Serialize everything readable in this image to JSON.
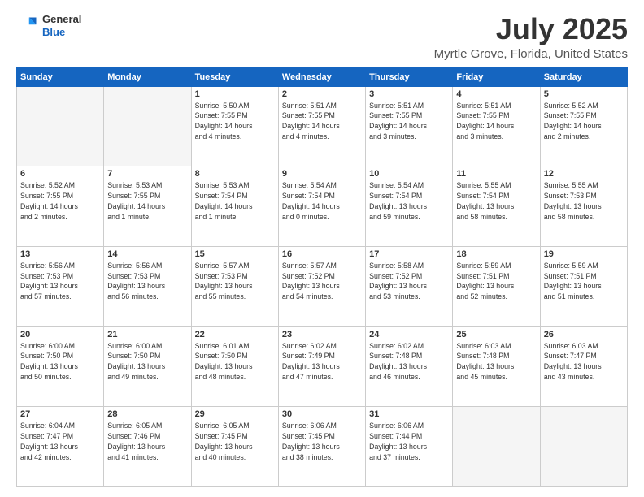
{
  "logo": {
    "general": "General",
    "blue": "Blue"
  },
  "header": {
    "title": "July 2025",
    "subtitle": "Myrtle Grove, Florida, United States"
  },
  "weekdays": [
    "Sunday",
    "Monday",
    "Tuesday",
    "Wednesday",
    "Thursday",
    "Friday",
    "Saturday"
  ],
  "weeks": [
    [
      {
        "day": "",
        "info": ""
      },
      {
        "day": "",
        "info": ""
      },
      {
        "day": "1",
        "info": "Sunrise: 5:50 AM\nSunset: 7:55 PM\nDaylight: 14 hours\nand 4 minutes."
      },
      {
        "day": "2",
        "info": "Sunrise: 5:51 AM\nSunset: 7:55 PM\nDaylight: 14 hours\nand 4 minutes."
      },
      {
        "day": "3",
        "info": "Sunrise: 5:51 AM\nSunset: 7:55 PM\nDaylight: 14 hours\nand 3 minutes."
      },
      {
        "day": "4",
        "info": "Sunrise: 5:51 AM\nSunset: 7:55 PM\nDaylight: 14 hours\nand 3 minutes."
      },
      {
        "day": "5",
        "info": "Sunrise: 5:52 AM\nSunset: 7:55 PM\nDaylight: 14 hours\nand 2 minutes."
      }
    ],
    [
      {
        "day": "6",
        "info": "Sunrise: 5:52 AM\nSunset: 7:55 PM\nDaylight: 14 hours\nand 2 minutes."
      },
      {
        "day": "7",
        "info": "Sunrise: 5:53 AM\nSunset: 7:55 PM\nDaylight: 14 hours\nand 1 minute."
      },
      {
        "day": "8",
        "info": "Sunrise: 5:53 AM\nSunset: 7:54 PM\nDaylight: 14 hours\nand 1 minute."
      },
      {
        "day": "9",
        "info": "Sunrise: 5:54 AM\nSunset: 7:54 PM\nDaylight: 14 hours\nand 0 minutes."
      },
      {
        "day": "10",
        "info": "Sunrise: 5:54 AM\nSunset: 7:54 PM\nDaylight: 13 hours\nand 59 minutes."
      },
      {
        "day": "11",
        "info": "Sunrise: 5:55 AM\nSunset: 7:54 PM\nDaylight: 13 hours\nand 58 minutes."
      },
      {
        "day": "12",
        "info": "Sunrise: 5:55 AM\nSunset: 7:53 PM\nDaylight: 13 hours\nand 58 minutes."
      }
    ],
    [
      {
        "day": "13",
        "info": "Sunrise: 5:56 AM\nSunset: 7:53 PM\nDaylight: 13 hours\nand 57 minutes."
      },
      {
        "day": "14",
        "info": "Sunrise: 5:56 AM\nSunset: 7:53 PM\nDaylight: 13 hours\nand 56 minutes."
      },
      {
        "day": "15",
        "info": "Sunrise: 5:57 AM\nSunset: 7:53 PM\nDaylight: 13 hours\nand 55 minutes."
      },
      {
        "day": "16",
        "info": "Sunrise: 5:57 AM\nSunset: 7:52 PM\nDaylight: 13 hours\nand 54 minutes."
      },
      {
        "day": "17",
        "info": "Sunrise: 5:58 AM\nSunset: 7:52 PM\nDaylight: 13 hours\nand 53 minutes."
      },
      {
        "day": "18",
        "info": "Sunrise: 5:59 AM\nSunset: 7:51 PM\nDaylight: 13 hours\nand 52 minutes."
      },
      {
        "day": "19",
        "info": "Sunrise: 5:59 AM\nSunset: 7:51 PM\nDaylight: 13 hours\nand 51 minutes."
      }
    ],
    [
      {
        "day": "20",
        "info": "Sunrise: 6:00 AM\nSunset: 7:50 PM\nDaylight: 13 hours\nand 50 minutes."
      },
      {
        "day": "21",
        "info": "Sunrise: 6:00 AM\nSunset: 7:50 PM\nDaylight: 13 hours\nand 49 minutes."
      },
      {
        "day": "22",
        "info": "Sunrise: 6:01 AM\nSunset: 7:50 PM\nDaylight: 13 hours\nand 48 minutes."
      },
      {
        "day": "23",
        "info": "Sunrise: 6:02 AM\nSunset: 7:49 PM\nDaylight: 13 hours\nand 47 minutes."
      },
      {
        "day": "24",
        "info": "Sunrise: 6:02 AM\nSunset: 7:48 PM\nDaylight: 13 hours\nand 46 minutes."
      },
      {
        "day": "25",
        "info": "Sunrise: 6:03 AM\nSunset: 7:48 PM\nDaylight: 13 hours\nand 45 minutes."
      },
      {
        "day": "26",
        "info": "Sunrise: 6:03 AM\nSunset: 7:47 PM\nDaylight: 13 hours\nand 43 minutes."
      }
    ],
    [
      {
        "day": "27",
        "info": "Sunrise: 6:04 AM\nSunset: 7:47 PM\nDaylight: 13 hours\nand 42 minutes."
      },
      {
        "day": "28",
        "info": "Sunrise: 6:05 AM\nSunset: 7:46 PM\nDaylight: 13 hours\nand 41 minutes."
      },
      {
        "day": "29",
        "info": "Sunrise: 6:05 AM\nSunset: 7:45 PM\nDaylight: 13 hours\nand 40 minutes."
      },
      {
        "day": "30",
        "info": "Sunrise: 6:06 AM\nSunset: 7:45 PM\nDaylight: 13 hours\nand 38 minutes."
      },
      {
        "day": "31",
        "info": "Sunrise: 6:06 AM\nSunset: 7:44 PM\nDaylight: 13 hours\nand 37 minutes."
      },
      {
        "day": "",
        "info": ""
      },
      {
        "day": "",
        "info": ""
      }
    ]
  ]
}
